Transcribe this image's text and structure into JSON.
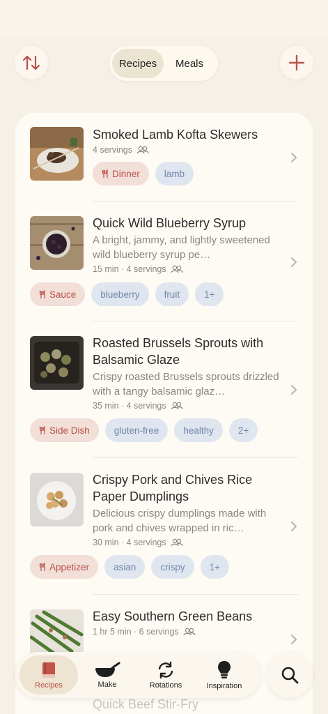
{
  "header": {
    "segments": [
      "Recipes",
      "Meals"
    ],
    "active_segment": "Recipes",
    "sort_icon": "sort-arrows-icon",
    "add_icon": "plus-icon"
  },
  "recipes": [
    {
      "title": "Smoked Lamb Kofta Skewers",
      "meta": "4 servings",
      "tags": {
        "category": "Dinner",
        "others": [
          "lamb"
        ]
      }
    },
    {
      "title": "Quick Wild Blueberry Syrup",
      "description": "A bright, jammy, and lightly sweetened wild blueberry syrup pe…",
      "meta": "15 min · 4 servings",
      "tags": {
        "category": "Sauce",
        "others": [
          "blueberry",
          "fruit",
          "1+"
        ]
      }
    },
    {
      "title": "Roasted Brussels Sprouts with Balsamic Glaze",
      "description": "Crispy roasted Brussels sprouts drizzled with a tangy balsamic glaz…",
      "meta": "35 min · 4 servings",
      "tags": {
        "category": "Side Dish",
        "others": [
          "gluten-free",
          "healthy",
          "2+"
        ]
      }
    },
    {
      "title": "Crispy Pork and Chives Rice Paper Dumplings",
      "description": "Delicious crispy dumplings made with pork and chives wrapped in ric…",
      "meta": "30 min · 4 servings",
      "tags": {
        "category": "Appetizer",
        "others": [
          "asian",
          "crispy",
          "1+"
        ]
      }
    },
    {
      "title": "Easy Southern Green Beans",
      "meta": "1 hr 5 min · 6 servings"
    }
  ],
  "peek_title": "Quick Beef Stir-Fry",
  "tabbar": {
    "tabs": [
      {
        "label": "Recipes",
        "icon": "book-icon"
      },
      {
        "label": "Make",
        "icon": "wok-icon"
      },
      {
        "label": "Rotations",
        "icon": "rotate-icon"
      },
      {
        "label": "Inspiration",
        "icon": "lightbulb-icon"
      }
    ],
    "active_tab": "Recipes",
    "search_icon": "search-icon"
  },
  "colors": {
    "background": "#f5f1e6",
    "card": "#fdfbf4",
    "accent": "#b9524a",
    "category_tag_bg": "#f2dfd8",
    "tag_bg": "#e0e6ef",
    "tag_text": "#6f87aa"
  }
}
